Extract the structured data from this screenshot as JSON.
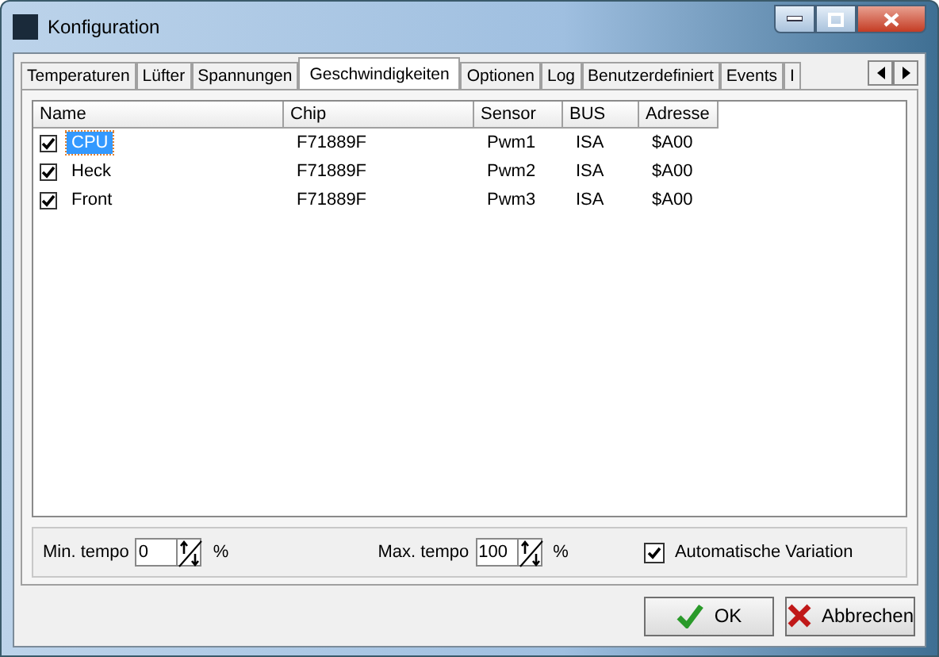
{
  "window": {
    "title": "Konfiguration"
  },
  "tabs": [
    {
      "label": "Temperaturen",
      "selected": false
    },
    {
      "label": "Lüfter",
      "selected": false
    },
    {
      "label": "Spannungen",
      "selected": false
    },
    {
      "label": "Geschwindigkeiten",
      "selected": true
    },
    {
      "label": "Optionen",
      "selected": false
    },
    {
      "label": "Log",
      "selected": false
    },
    {
      "label": "Benutzerdefiniert",
      "selected": false
    },
    {
      "label": "Events",
      "selected": false
    },
    {
      "label": "I",
      "selected": false
    }
  ],
  "table": {
    "columns": [
      "Name",
      "Chip",
      "Sensor",
      "BUS",
      "Adresse"
    ],
    "rows": [
      {
        "checked": true,
        "selected": true,
        "cells": [
          "CPU",
          "F71889F",
          "Pwm1",
          "ISA",
          "$A00"
        ]
      },
      {
        "checked": true,
        "selected": false,
        "cells": [
          "Heck",
          "F71889F",
          "Pwm2",
          "ISA",
          "$A00"
        ]
      },
      {
        "checked": true,
        "selected": false,
        "cells": [
          "Front",
          "F71889F",
          "Pwm3",
          "ISA",
          "$A00"
        ]
      }
    ]
  },
  "tempo": {
    "min_label": "Min. tempo",
    "min_value": "0",
    "min_unit": "%",
    "max_label": "Max. tempo",
    "max_value": "100",
    "max_unit": "%",
    "auto_variation": {
      "label": "Automatische Variation",
      "checked": true
    }
  },
  "buttons": [
    {
      "kind": "ok",
      "label": "OK"
    },
    {
      "kind": "cancel",
      "label": "Abbrechen"
    }
  ]
}
